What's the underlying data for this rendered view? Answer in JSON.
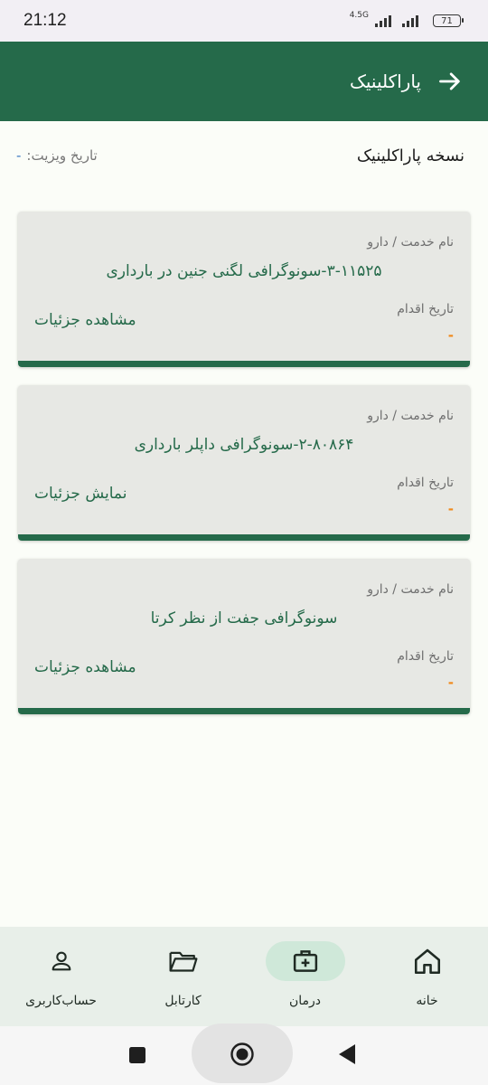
{
  "status_bar": {
    "time": "21:12",
    "network": "4.5G",
    "battery": "71"
  },
  "app_bar": {
    "title": "پاراکلینیک",
    "back_icon": "arrow-right-icon"
  },
  "header": {
    "title": "نسخه پاراکلینیک",
    "visit_date_label": "تاریخ ویزیت:",
    "visit_date_value": "-"
  },
  "cards": [
    {
      "service_label": "نام خدمت / دارو",
      "service_name": "۳-۱۱۵۲۵-سونوگرافی لگنی جنین در بارداری",
      "date_label": "تاریخ اقدام",
      "date_value": "-",
      "details_label": "مشاهده جزئیات"
    },
    {
      "service_label": "نام خدمت / دارو",
      "service_name": "۲-۸۰۸۶۴-سونوگرافی داپلر بارداری",
      "date_label": "تاریخ اقدام",
      "date_value": "-",
      "details_label": "نمایش جزئیات"
    },
    {
      "service_label": "نام خدمت / دارو",
      "service_name": "سونوگرافی جفت از نظر کرتا",
      "date_label": "تاریخ اقدام",
      "date_value": "-",
      "details_label": "مشاهده جزئیات"
    }
  ],
  "bottom_nav": [
    {
      "label": "حساب‌کاربری",
      "icon": "user-icon",
      "active": false
    },
    {
      "label": "کارتابل",
      "icon": "folder-icon",
      "active": false
    },
    {
      "label": "درمان",
      "icon": "medical-kit-icon",
      "active": true
    },
    {
      "label": "خانه",
      "icon": "home-icon",
      "active": false
    }
  ],
  "colors": {
    "primary": "#256a4a",
    "active_nav_bg": "#cfe8d9",
    "date_accent": "#f08a1c"
  }
}
